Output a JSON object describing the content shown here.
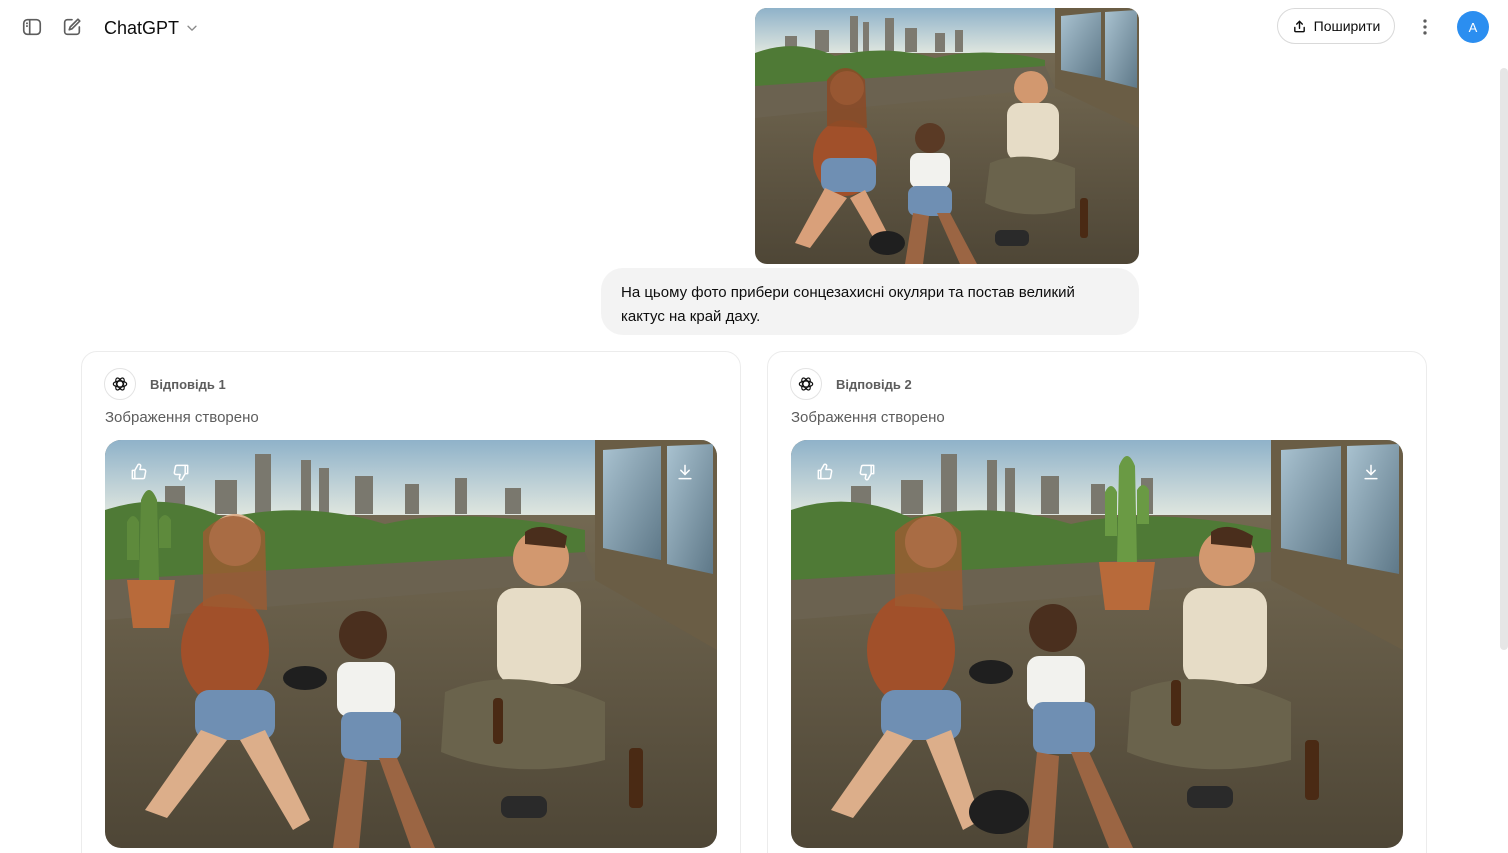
{
  "header": {
    "model_name": "ChatGPT",
    "share_label": "Поширити",
    "avatar_initial": "A"
  },
  "user_message": {
    "text": "На цьому фото прибери сонцезахисні окуляри та постав великий кактус на край даху."
  },
  "responses": [
    {
      "title": "Відповідь 1",
      "status": "Зображення створено"
    },
    {
      "title": "Відповідь 2",
      "status": "Зображення створено"
    }
  ],
  "icons": {
    "sidebar_toggle": "sidebar-icon",
    "new_chat": "edit-icon",
    "model_dropdown": "chevron-down-icon",
    "share": "share-icon",
    "more": "more-vertical-icon",
    "like": "thumbs-up-icon",
    "dislike": "thumbs-down-icon",
    "download": "download-icon",
    "assistant": "openai-logo-icon"
  },
  "colors": {
    "avatar_bg": "#2b8ef0",
    "bubble_bg": "#f3f3f3"
  }
}
